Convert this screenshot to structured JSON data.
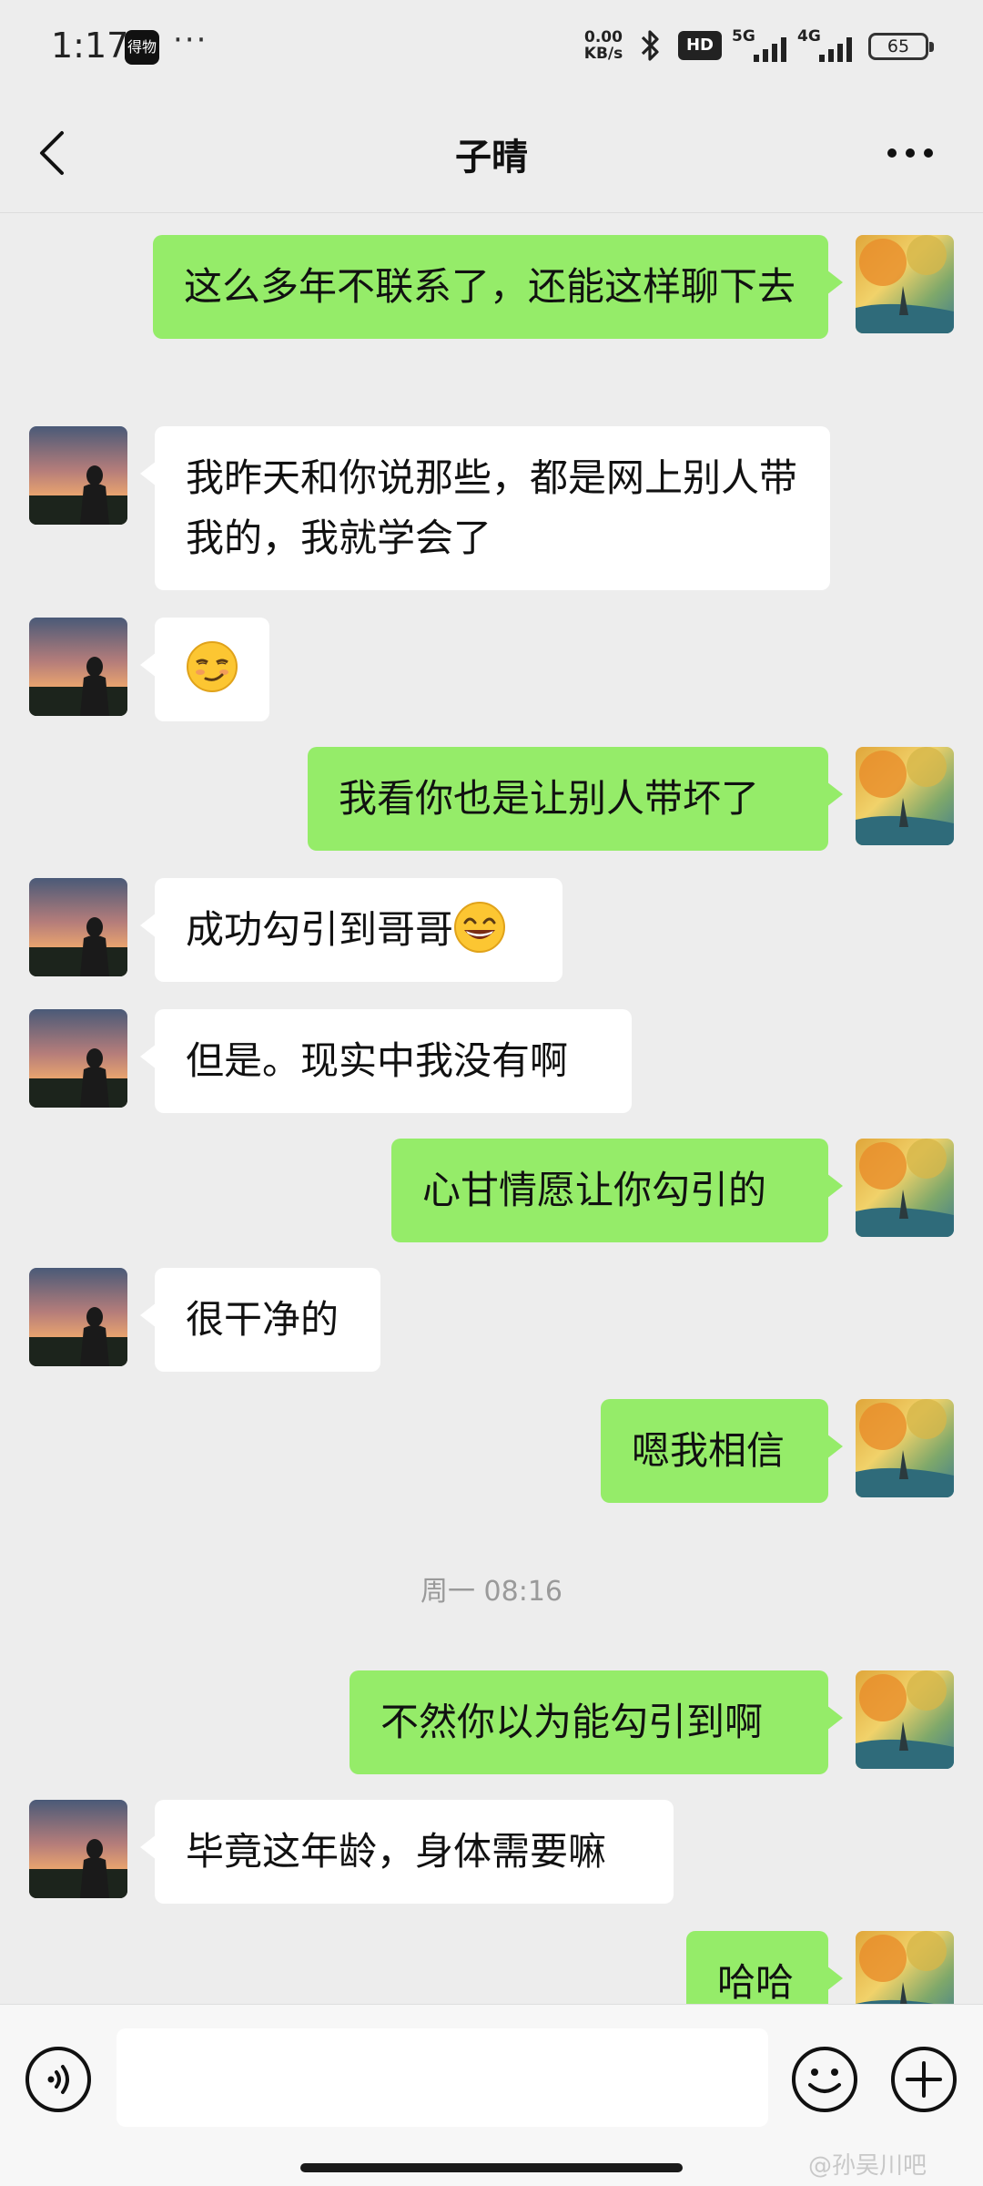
{
  "status_bar": {
    "time": "1:17",
    "app_badge": "得物",
    "dots": "···",
    "net_speed_value": "0.00",
    "net_speed_unit": "KB/s",
    "hd_label": "HD",
    "signal1_label": "5G",
    "signal2_label": "4G",
    "battery": "65"
  },
  "nav": {
    "title": "子晴"
  },
  "messages": [
    {
      "side": "me",
      "text": "这么多年不联系了，还能这样聊下去"
    },
    {
      "side": "them",
      "text": "我昨天和你说那些，都是网上别人带我的，我就学会了"
    },
    {
      "side": "them",
      "emoji": "smirk-emoji"
    },
    {
      "side": "me",
      "text": "我看你也是让别人带坏了"
    },
    {
      "side": "them",
      "text": "成功勾引到哥哥",
      "emoji": "grin-emoji"
    },
    {
      "side": "them",
      "text": "但是。现实中我没有啊"
    },
    {
      "side": "me",
      "text": "心甘情愿让你勾引的"
    },
    {
      "side": "them",
      "text": "很干净的"
    },
    {
      "side": "me",
      "text": "嗯我相信"
    },
    {
      "side": "me",
      "text": "不然你以为能勾引到啊"
    },
    {
      "side": "them",
      "text": "毕竟这年龄，身体需要嘛"
    },
    {
      "side": "me",
      "text": "哈哈"
    }
  ],
  "timestamp": "周一 08:16",
  "input_bar": {
    "text_value": "",
    "watermark": "@孙吴川吧"
  },
  "icons": {
    "back": "chevron-left-icon",
    "more": "more-dots-icon",
    "voice": "voice-icon",
    "emoji": "emoji-icon",
    "plus": "plus-icon"
  },
  "colors": {
    "my_bubble": "#95ec69",
    "their_bubble": "#ffffff",
    "background": "#ededed"
  }
}
